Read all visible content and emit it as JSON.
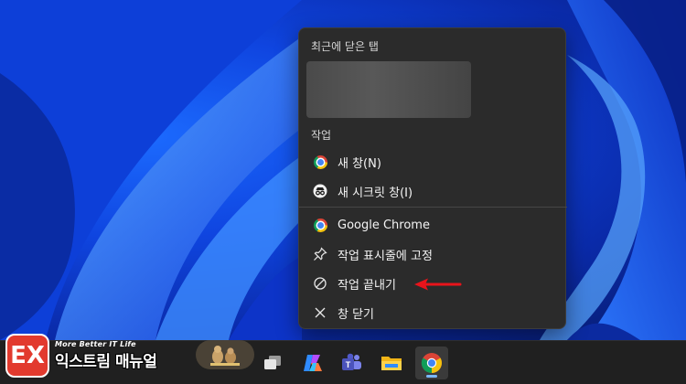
{
  "context_menu": {
    "recent_section_title": "최근에 닫은 탭",
    "tasks_section_title": "작업",
    "items": [
      {
        "label": "새 창(N)",
        "icon": "chrome-icon"
      },
      {
        "label": "새 시크릿 창(I)",
        "icon": "incognito-icon"
      },
      {
        "label": "Google Chrome",
        "icon": "chrome-icon"
      },
      {
        "label": "작업 표시줄에 고정",
        "icon": "pin-icon"
      },
      {
        "label": "작업 끝내기",
        "icon": "end-task-icon"
      },
      {
        "label": "창 닫기",
        "icon": "close-icon"
      }
    ]
  },
  "watermark": {
    "badge": "EX",
    "tagline": "More Better IT Life",
    "name": "익스트림 매뉴얼"
  },
  "taskbar": {
    "apps": [
      "task-view-icon",
      "copilot-icon",
      "teams-icon",
      "file-explorer-icon",
      "chrome-icon"
    ],
    "active_app": "chrome-icon"
  },
  "annotation": {
    "arrow_color": "#e8141b"
  }
}
